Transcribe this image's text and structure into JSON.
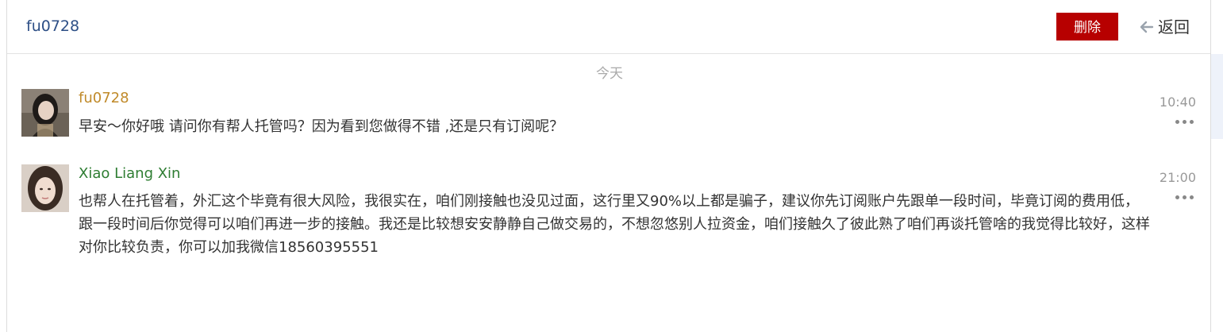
{
  "header": {
    "title": "fu0728",
    "delete_label": "删除",
    "back_label": "返回"
  },
  "date_separator": "今天",
  "messages": [
    {
      "sender": "fu0728",
      "name_color": "#c08a2a",
      "time": "10:40",
      "text": "早安～你好哦 请问你有帮人托管吗？因为看到您做得不错 ,还是只有订阅呢？"
    },
    {
      "sender": "Xiao Liang Xin",
      "name_color": "#2e7d32",
      "time": "21:00",
      "text": "也帮人在托管着，外汇这个毕竟有很大风险，我很实在，咱们刚接触也没见过面，这行里又90%以上都是骗子，建议你先订阅账户先跟单一段时间，毕竟订阅的费用低，跟一段时间后你觉得可以咱们再进一步的接触。我还是比较想安安静静自己做交易的，不想忽悠别人拉资金，咱们接触久了彼此熟了咱们再谈托管啥的我觉得比较好，这样对你比较负责，你可以加我微信18560395551"
    }
  ],
  "colors": {
    "delete_bg": "#b70000",
    "title": "#2d4f86"
  }
}
